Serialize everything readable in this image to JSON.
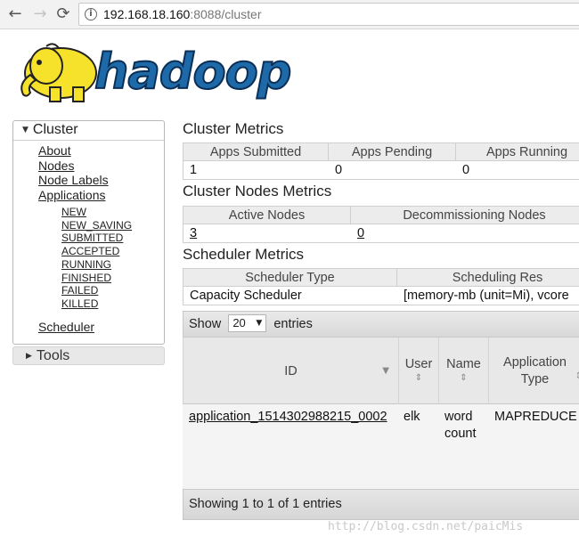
{
  "browser": {
    "back_icon": "←",
    "forward_icon": "→",
    "reload_icon": "⟳",
    "info_icon": "i",
    "url_host": "192.168.18.160",
    "url_rest": ":8088/cluster"
  },
  "logo": {
    "wordmark": "hadoop"
  },
  "sidebar": {
    "cluster_label": "Cluster",
    "cluster_toggle": "▼",
    "links": [
      "About",
      "Nodes",
      "Node Labels",
      "Applications"
    ],
    "app_states": [
      "NEW",
      "NEW_SAVING",
      "SUBMITTED",
      "ACCEPTED",
      "RUNNING",
      "FINISHED",
      "FAILED",
      "KILLED"
    ],
    "scheduler_label": "Scheduler",
    "tools_label": "Tools",
    "tools_toggle": "▶"
  },
  "cluster_metrics": {
    "title": "Cluster Metrics",
    "headers": [
      "Apps Submitted",
      "Apps Pending",
      "Apps Running"
    ],
    "values": [
      "1",
      "0",
      "0"
    ]
  },
  "node_metrics": {
    "title": "Cluster Nodes Metrics",
    "headers": [
      "Active Nodes",
      "Decommissioning Nodes"
    ],
    "values": [
      "3",
      "0"
    ]
  },
  "scheduler_metrics": {
    "title": "Scheduler Metrics",
    "headers": [
      "Scheduler Type",
      "Scheduling Res"
    ],
    "values": [
      "Capacity Scheduler",
      "[memory-mb (unit=Mi), vcore"
    ]
  },
  "apps_table": {
    "show_label": "Show",
    "entries_label": "entries",
    "page_size": "20",
    "columns": [
      {
        "lines": [
          "ID"
        ],
        "sort": "▼"
      },
      {
        "lines": [
          "User"
        ],
        "sort": "⇕"
      },
      {
        "lines": [
          "Name"
        ],
        "sort": "⇕"
      },
      {
        "lines": [
          "Application",
          "Type"
        ],
        "sort": "⇕"
      }
    ],
    "rows": [
      {
        "id": "application_1514302988215_0002",
        "user": "elk",
        "name": [
          "word",
          "count"
        ],
        "type": "MAPREDUCE"
      }
    ],
    "footer": "Showing 1 to 1 of 1 entries"
  },
  "watermark": "http://blog.csdn.net/paicMis"
}
